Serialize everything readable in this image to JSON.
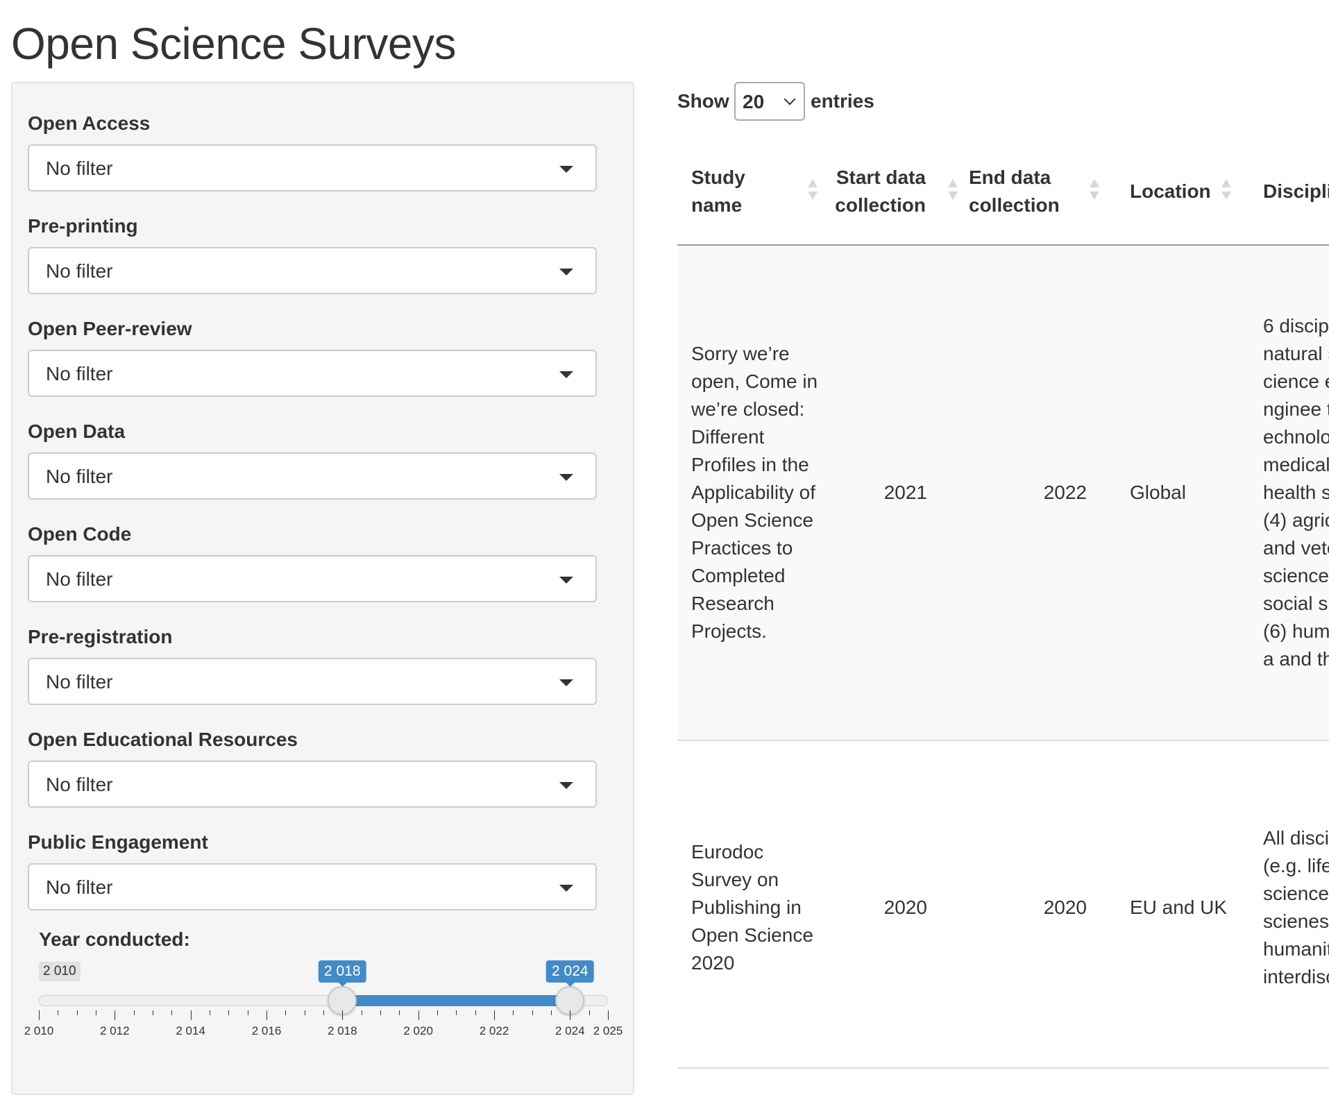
{
  "page": {
    "title": "Open Science Surveys"
  },
  "filters": [
    {
      "label": "Open Access",
      "value": "No filter"
    },
    {
      "label": "Pre-printing",
      "value": "No filter"
    },
    {
      "label": "Open Peer-review",
      "value": "No filter"
    },
    {
      "label": "Open Data",
      "value": "No filter"
    },
    {
      "label": "Open Code",
      "value": "No filter"
    },
    {
      "label": "Pre-registration",
      "value": "No filter"
    },
    {
      "label": "Open Educational Resources",
      "value": "No filter"
    },
    {
      "label": "Public Engagement",
      "value": "No filter"
    }
  ],
  "year_slider": {
    "label": "Year conducted:",
    "min": 2010,
    "max": 2025,
    "min_label": "2 010",
    "from": 2018,
    "to": 2024,
    "from_label": "2 018",
    "to_label": "2 024",
    "tick_labels": [
      {
        "year": 2010,
        "text": "2 010"
      },
      {
        "year": 2012,
        "text": "2 012"
      },
      {
        "year": 2014,
        "text": "2 014"
      },
      {
        "year": 2016,
        "text": "2 016"
      },
      {
        "year": 2018,
        "text": "2 018"
      },
      {
        "year": 2020,
        "text": "2 020"
      },
      {
        "year": 2022,
        "text": "2 022"
      },
      {
        "year": 2024,
        "text": "2 024"
      },
      {
        "year": 2025,
        "text": "2 025"
      }
    ],
    "accent_color": "#428bca"
  },
  "table_controls": {
    "show_label": "Show",
    "page_length": "20",
    "entries_label": "entries"
  },
  "table": {
    "columns": [
      "Study name",
      "Start data collection",
      "End data collection",
      "Location",
      "Discipli"
    ],
    "rows": [
      {
        "study_name": "Sorry we’re open, Come in we’re closed: Different Profiles in the Applicability of Open Science Practices to Completed Research Projects.",
        "start": "2021",
        "end": "2022",
        "location": "Global",
        "discipline": "6 discip natural science enginee technolo medical health s (4) agric and vete science social s (6) huma and the"
      },
      {
        "study_name": "Eurodoc Survey on Publishing in Open Science 2020",
        "start": "2020",
        "end": "2020",
        "location": "EU and UK",
        "discipline": "All disci (e.g. life science scienes humanit interdisc"
      }
    ]
  }
}
